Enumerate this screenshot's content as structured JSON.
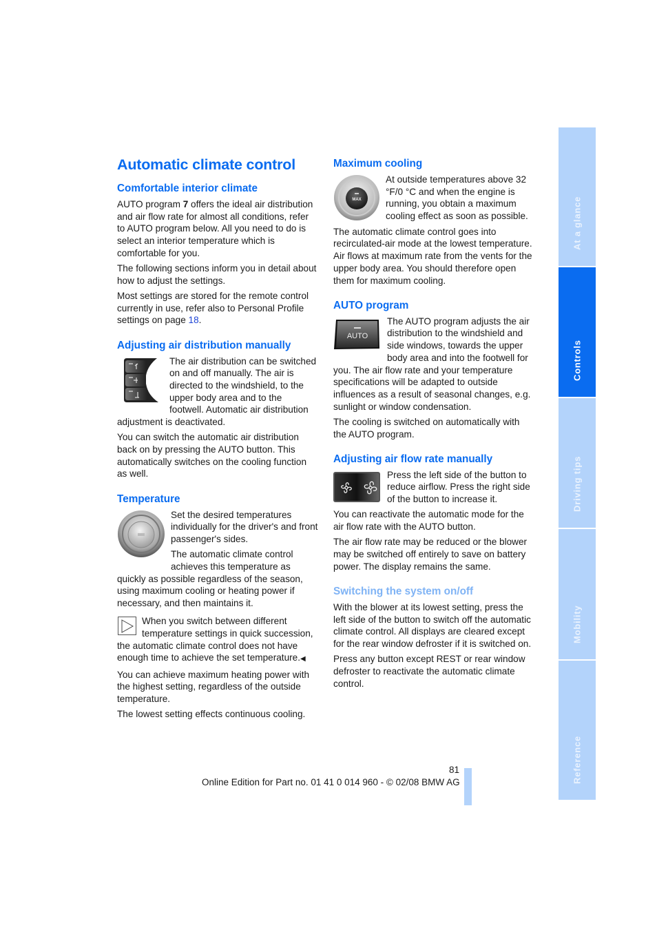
{
  "page": {
    "title": "Automatic climate control",
    "page_number": "81",
    "footer": "Online Edition for Part no. 01 41 0 014 960 - © 02/08 BMW AG"
  },
  "side_tabs": [
    {
      "label": "At a glance",
      "active": false
    },
    {
      "label": "Controls",
      "active": true
    },
    {
      "label": "Driving tips",
      "active": false
    },
    {
      "label": "Mobility",
      "active": false
    },
    {
      "label": "Reference",
      "active": false
    }
  ],
  "colors": {
    "accent": "#0a6cf0",
    "tab_inactive": "#b3d3fb",
    "link": "#1f45d6"
  },
  "left": {
    "comfortable": {
      "heading": "Comfortable interior climate",
      "p1_a": "AUTO program ",
      "p1_bold": "7",
      "p1_b": " offers the ideal air distribution and air flow rate for almost all conditions, refer to AUTO program below. All you need to do is select an interior temperature which is comfortable for you.",
      "p2": "The following sections inform you in detail about how to adjust the settings.",
      "p3_a": "Most settings are stored for the remote control currently in use, refer also to Personal Profile settings on page ",
      "p3_link": "18",
      "p3_b": "."
    },
    "air_distribution": {
      "heading": "Adjusting air distribution manually",
      "image_icon": "air-distribution-buttons",
      "p1": "The air distribution can be switched on and off manually. The air is directed to the windshield, to the upper body area and to the footwell. Automatic air distribution adjustment is deactivated.",
      "p2": "You can switch the automatic air distribution back on by pressing the AUTO button. This automatically switches on the cooling function as well."
    },
    "temperature": {
      "heading": "Temperature",
      "image_icon": "temperature-dial",
      "p1": "Set the desired temperatures individually for the driver's and front passenger's sides.",
      "p2": "The automatic climate control achieves this temperature as quickly as possible regardless of the season, using maximum cooling or heating power if necessary, and then maintains it.",
      "note_icon": "note-triangle-icon",
      "note": "When you switch between different temperature settings in quick succession, the automatic climate control does not have enough time to achieve the set temperature.",
      "end_mark": "◀",
      "p3": "You can achieve maximum heating power with the highest setting, regardless of the outside temperature.",
      "p4": "The lowest setting effects continuous cooling."
    }
  },
  "right": {
    "max_cooling": {
      "heading": "Maximum cooling",
      "image_icon": "max-cooling-dial",
      "button_label": "MAX",
      "p1": "At outside temperatures above 32 °F/0 °C and when the engine is running, you obtain a maximum cooling effect as soon as possible.",
      "p2": "The automatic climate control goes into recirculated-air mode at the lowest temperature. Air flows at maximum rate from the vents for the upper body area. You should therefore open them for maximum cooling."
    },
    "auto_program": {
      "heading": "AUTO program",
      "image_icon": "auto-button",
      "button_label": "AUTO",
      "p1": "The AUTO program adjusts the air distribution to the windshield and side windows, towards the upper body area and into the footwell for you. The air flow rate and your temperature specifications will be adapted to outside influences as a result of seasonal changes, e.g. sunlight or window condensation.",
      "p2": "The cooling is switched on automatically with the AUTO program."
    },
    "air_flow": {
      "heading": "Adjusting air flow rate manually",
      "image_icon": "fan-buttons",
      "p1": "Press the left side of the button to reduce airflow. Press the right side of the button to increase it.",
      "p2": "You can reactivate the automatic mode for the air flow rate with the AUTO button.",
      "p3": "The air flow rate may be reduced or the blower may be switched off entirely to save on battery power. The display remains the same."
    },
    "on_off": {
      "heading": "Switching the system on/off",
      "p1": "With the blower at its lowest setting, press the left side of the button to switch off the automatic climate control. All displays are cleared except for the rear window defroster if it is switched on.",
      "p2": "Press any button except REST or rear window defroster to reactivate the automatic climate control."
    }
  }
}
